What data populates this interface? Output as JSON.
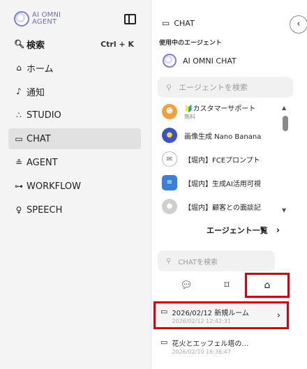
{
  "app": {
    "logo_line1": "AI OMNI",
    "logo_line2": "AGENT"
  },
  "sidebar": {
    "items": [
      {
        "label": "検索",
        "icon": "search-icon",
        "shortcut": "Ctrl + K"
      },
      {
        "label": "ホーム",
        "icon": "home-icon"
      },
      {
        "label": "通知",
        "icon": "bell-icon"
      },
      {
        "label": "STUDIO",
        "icon": "studio-icon"
      },
      {
        "label": "CHAT",
        "icon": "chat-icon",
        "active": true
      },
      {
        "label": "AGENT",
        "icon": "agent-icon"
      },
      {
        "label": "WORKFLOW",
        "icon": "workflow-icon"
      },
      {
        "label": "SPEECH",
        "icon": "mic-icon"
      }
    ]
  },
  "chat_panel": {
    "header": "CHAT",
    "section_label": "使用中のエージェント",
    "current_agent": "AI OMNI CHAT",
    "agent_search_placeholder": "エージェントを検索",
    "agents": [
      {
        "name": "🔰カスタマーサポート",
        "sub": "無料"
      },
      {
        "name": "画像生成 Nano Banana"
      },
      {
        "name": "【堀内】FCEプロンプト"
      },
      {
        "name": "【堀内】生成AI活用可視"
      },
      {
        "name": "【堀内】顧客との面談記"
      }
    ],
    "agent_all_label": "エージェント一覧",
    "chat_search_placeholder": "CHATを検索",
    "tabs": [
      "chat-bubble-icon",
      "bookmark-icon",
      "inbox-icon"
    ],
    "chats": [
      {
        "title": "2026/02/12 新規ルーム",
        "date": "2026/02/12 12:42:31"
      },
      {
        "title": "花火とエッフェル塔の…",
        "date": "2026/02/10 16:36:47"
      }
    ]
  },
  "colors": {
    "highlight": "#d9000d",
    "accent": "#7b7fd1",
    "active_bg": "#e1e1e1"
  }
}
